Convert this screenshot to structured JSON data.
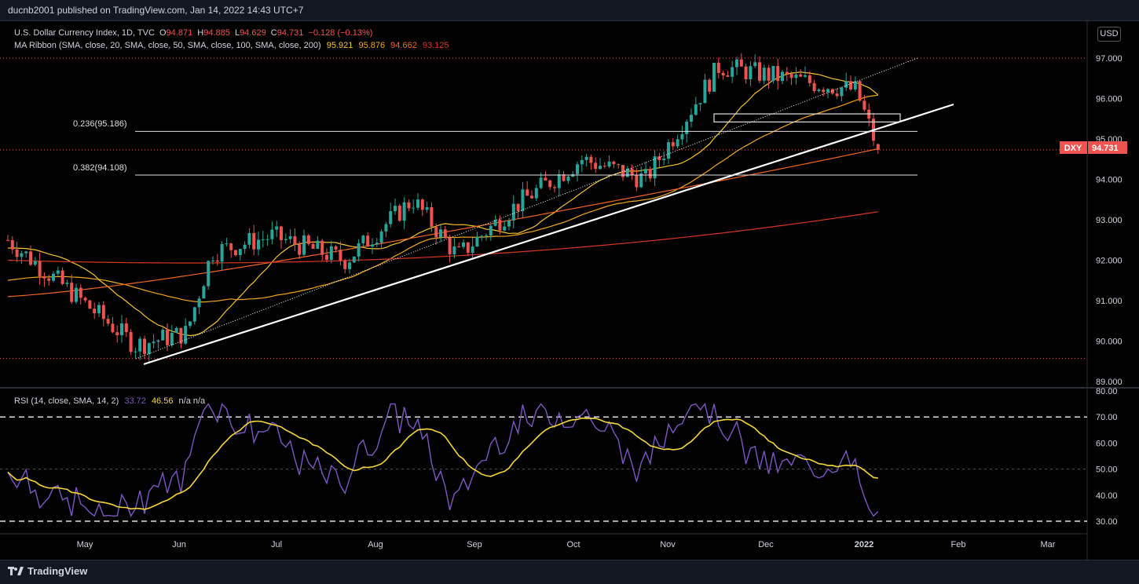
{
  "header": {
    "published_text": "ducnb2001 published on TradingView.com, Jan 14, 2022 14:43 UTC+7"
  },
  "footer": {
    "brand": "TradingView"
  },
  "currency_button": "USD",
  "legend": {
    "main": {
      "symbol": "U.S. Dollar Currency Index, 1D, TVC",
      "o_label": "O",
      "o_value": "94.871",
      "h_label": "H",
      "h_value": "94.885",
      "l_label": "L",
      "l_value": "94.629",
      "c_label": "C",
      "c_value": "94.731",
      "change": "−0.128 (−0.13%)"
    },
    "ma": {
      "label": "MA Ribbon (SMA, close, 20, SMA, close, 50, SMA, close, 100, SMA, close, 200)",
      "v20": "95.921",
      "v50": "95.876",
      "v100": "94.662",
      "v200": "93.125"
    },
    "rsi": {
      "label": "RSI (14, close, SMA, 14, 2)",
      "rsi_value": "33.72",
      "sma_value": "46.56",
      "na": "n/a  n/a"
    }
  },
  "fib": {
    "f236_label": "0.236(95.186)",
    "f382_label": "0.382(94.108)"
  },
  "price_tag": {
    "symbol": "DXY",
    "value": "94.731"
  },
  "colors": {
    "up": "#26a69a",
    "down": "#ef5350",
    "ma20": "#f7c42f",
    "ma50": "#f2a81e",
    "ma100": "#f26522",
    "ma200": "#d93621",
    "rsi": "#7e57c2",
    "rsi_ma": "#f5d73a"
  },
  "chart_data": [
    {
      "type": "candlestick",
      "title": "U.S. Dollar Currency Index, 1D, TVC",
      "y_axis": {
        "ticks": [
          "97.000",
          "96.000",
          "95.000",
          "94.000",
          "93.000",
          "92.000",
          "91.000",
          "90.000",
          "89.000"
        ],
        "range": [
          88.8,
          97.5
        ]
      },
      "x_axis": {
        "ticks": [
          "May",
          "Jun",
          "Jul",
          "Aug",
          "Sep",
          "Oct",
          "Nov",
          "Dec",
          "2022",
          "Feb",
          "Mar"
        ]
      },
      "approx_close_path": [
        {
          "d": "2021-04-15",
          "c": 92.5
        },
        {
          "d": "2021-05-05",
          "c": 91.2
        },
        {
          "d": "2021-05-25",
          "c": 89.9
        },
        {
          "d": "2021-06-10",
          "c": 90.2
        },
        {
          "d": "2021-06-18",
          "c": 92.2
        },
        {
          "d": "2021-07-07",
          "c": 92.6
        },
        {
          "d": "2021-07-30",
          "c": 92.0
        },
        {
          "d": "2021-08-20",
          "c": 93.5
        },
        {
          "d": "2021-09-03",
          "c": 92.1
        },
        {
          "d": "2021-09-22",
          "c": 93.4
        },
        {
          "d": "2021-10-12",
          "c": 94.5
        },
        {
          "d": "2021-11-01",
          "c": 94.0
        },
        {
          "d": "2021-11-24",
          "c": 96.8
        },
        {
          "d": "2021-12-15",
          "c": 96.5
        },
        {
          "d": "2022-01-06",
          "c": 96.2
        },
        {
          "d": "2022-01-13",
          "c": 94.7
        }
      ],
      "fib_levels": [
        {
          "ratio": 0.236,
          "price": 95.186
        },
        {
          "ratio": 0.382,
          "price": 94.108
        }
      ],
      "series": [
        {
          "name": "SMA 20",
          "last": 95.921
        },
        {
          "name": "SMA 50",
          "last": 95.876
        },
        {
          "name": "SMA 100",
          "last": 94.662
        },
        {
          "name": "SMA 200",
          "last": 93.125
        }
      ],
      "last_price": 94.731
    },
    {
      "type": "line",
      "title": "RSI (14, close, SMA, 14, 2)",
      "y_axis": {
        "ticks": [
          "80.00",
          "70.00",
          "60.00",
          "50.00",
          "40.00",
          "30.00"
        ],
        "range": [
          27,
          80
        ]
      },
      "levels": [
        70,
        50,
        30
      ],
      "series": [
        {
          "name": "RSI",
          "last": 33.72
        },
        {
          "name": "RSI SMA",
          "last": 46.56
        }
      ]
    }
  ]
}
